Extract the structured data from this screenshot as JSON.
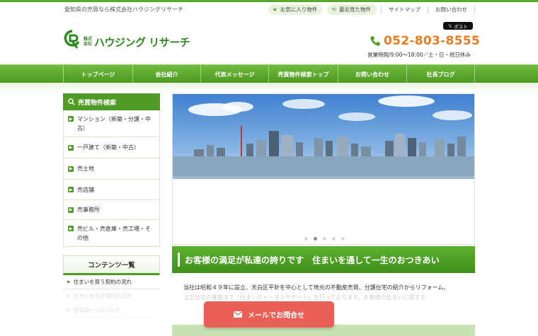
{
  "header": {
    "tagline": "愛知県の売買なら株式会社ハウジングリサーチ",
    "favorites_label": "お気に入り物件",
    "recent_label": "最近見た物件",
    "sitemap_label": "サイトマップ",
    "contact_label": "お問い合わせ",
    "logo_kabu_1": "株式",
    "logo_kabu_2": "会社",
    "logo_name": "ハウジング リサーチ",
    "x_post_label": "ポスト",
    "phone": "052-803-8555",
    "hours": "営業時間/9:00〜18:00／土・日・祝日休み"
  },
  "nav": {
    "items": [
      "トップページ",
      "会社紹介",
      "代表メッセージ",
      "売買物件検索トップ",
      "お問い合わせ",
      "社長ブログ"
    ]
  },
  "sidebar": {
    "search_title": "売買物件検索",
    "search_items": [
      "マンション（新築・分譲・中古）",
      "一戸建て（新築・中古）",
      "売土地",
      "売店舗",
      "売事務所",
      "売ビル・売倉庫・売工場・その他"
    ],
    "contents_title": "コンテンツ一覧",
    "contents_items": [
      "住まいを買う契約の流れ",
      "住まいを売る契約の流れ",
      "住宅ローンについて"
    ]
  },
  "slider": {
    "dots": 5,
    "active_dot": 1
  },
  "main": {
    "banner": "お客様の満足が私達の誇りです　住まいを通して一生のおつきあい",
    "intro_line1": "当社は昭和４９年に設立、天白区平針を中心として地元の不動産売買、分譲住宅の紹介からリフォーム、",
    "intro_line2": "注文住宅の建築まで「住まいのトータルサポート」を行っております。お客様の住まいに関する"
  },
  "float_button": {
    "label": "メールでお問合せ"
  },
  "colors": {
    "brand_green": "#4f9c25",
    "phone_orange": "#ef7a1a",
    "mail_red": "#e95f55"
  }
}
